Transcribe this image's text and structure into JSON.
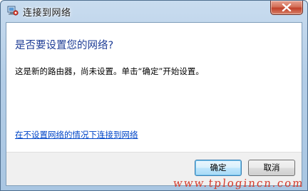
{
  "window": {
    "title": "连接到网络",
    "app_icon": "network-icon",
    "close_icon": "close-icon"
  },
  "dialog": {
    "heading": "是否要设置您的网络?",
    "message": "这是新的路由器，尚未设置。单击“确定”开始设置。",
    "skip_link": "在不设置网络的情况下连接到网络"
  },
  "buttons": {
    "ok": "确定",
    "cancel": "取消"
  },
  "watermark": "www.tplogincn.com",
  "colors": {
    "heading": "#1e3d96",
    "link": "#0046c8",
    "close_button": "#c1412a",
    "watermark": "#d43a2a"
  }
}
